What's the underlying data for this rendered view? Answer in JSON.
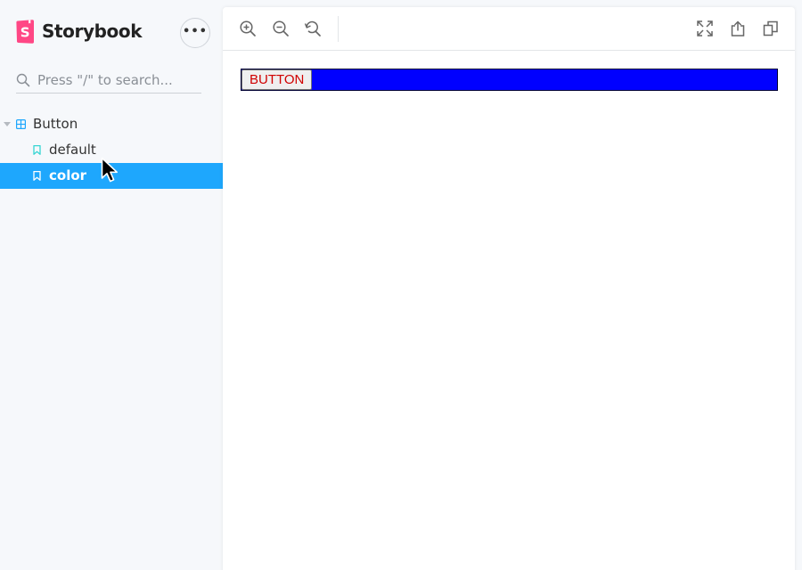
{
  "app": {
    "name": "Storybook",
    "colors": {
      "brand": "#ff4785",
      "accent": "#1ea7fd",
      "story_icon": "#37d5d3",
      "component_icon": "#1ea7fd"
    }
  },
  "sidebar": {
    "menu_icon": "ellipsis-icon",
    "search": {
      "placeholder": "Press \"/\" to search...",
      "value": "",
      "icon": "search-icon"
    },
    "tree": {
      "group": {
        "label": "Button",
        "icon": "component-icon",
        "expanded": true
      },
      "stories": [
        {
          "label": "default",
          "icon": "bookmark-icon",
          "selected": false
        },
        {
          "label": "color",
          "icon": "bookmark-icon",
          "selected": true
        }
      ]
    }
  },
  "toolbar": {
    "left": [
      "zoom-in-icon",
      "zoom-out-icon",
      "reset-zoom-icon"
    ],
    "right": [
      "fullscreen-icon",
      "share-icon",
      "copy-icon"
    ]
  },
  "preview": {
    "button_label": "BUTTON",
    "colors": {
      "container_bg": "#0000ff",
      "button_text": "#d00000"
    }
  }
}
